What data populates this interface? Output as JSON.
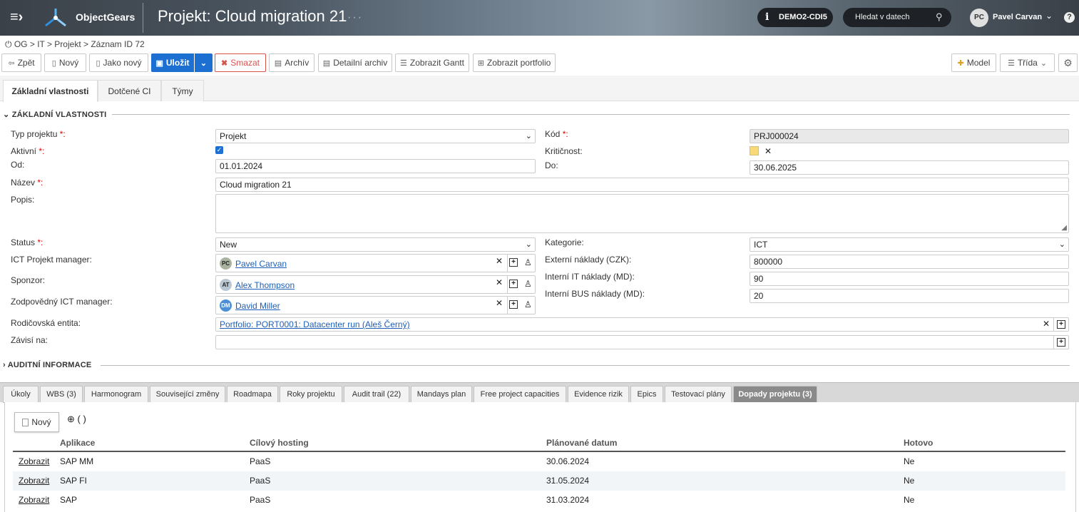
{
  "header": {
    "brand": "ObjectGears",
    "title": "Projekt: Cloud migration 21",
    "env": "DEMO2-CDI5",
    "search_placeholder": "Hledat v datech",
    "user_initials": "PC",
    "user_name": "Pavel Carvan"
  },
  "breadcrumb": "OG > IT > Projekt > Záznam ID 72",
  "toolbar": {
    "back": "Zpět",
    "new": "Nový",
    "as_new": "Jako nový",
    "save": "Uložit",
    "delete": "Smazat",
    "archive": "Archív",
    "detail_archive": "Detailní archiv",
    "gantt": "Zobrazit Gantt",
    "portfolio": "Zobrazit portfolio",
    "model": "Model",
    "class": "Třída"
  },
  "top_tabs": [
    "Základní vlastnosti",
    "Dotčené CI",
    "Týmy"
  ],
  "sections": {
    "basic": "ZÁKLADNÍ VLASTNOSTI",
    "audit": "AUDITNÍ INFORMACE"
  },
  "form": {
    "typ_label": "Typ projektu",
    "typ_value": "Projekt",
    "aktivni_label": "Aktivní",
    "od_label": "Od:",
    "od_value": "01.01.2024",
    "nazev_label": "Název",
    "nazev_value": "Cloud migration 21",
    "popis_label": "Popis:",
    "status_label": "Status",
    "status_value": "New",
    "pm_label": "ICT Projekt manager:",
    "sponzor_label": "Sponzor:",
    "zodp_label": "Zodpovědný ICT manager:",
    "rodic_label": "Rodičovská entita:",
    "rodic_value": "Portfolio: PORT0001: Datacenter run (Aleš Černý)",
    "zavisi_label": "Závisí na:",
    "kod_label": "Kód",
    "kod_value": "PRJ000024",
    "kriticnost_label": "Kritičnost:",
    "do_label": "Do:",
    "do_value": "30.06.2025",
    "kategorie_label": "Kategorie:",
    "kategorie_value": "ICT",
    "ext_label": "Externí náklady (CZK):",
    "ext_value": "800000",
    "intit_label": "Interní IT náklady (MD):",
    "intit_value": "90",
    "intbus_label": "Interní BUS náklady (MD):",
    "intbus_value": "20",
    "req_mark": "*:"
  },
  "people": {
    "pm": {
      "initials": "PC",
      "name": "Pavel Carvan",
      "color": "#a8b3a0"
    },
    "sponzor": {
      "initials": "AT",
      "name": "Alex Thompson",
      "color": "#b9c7d3"
    },
    "zodp": {
      "initials": "DM",
      "name": "David Miller",
      "color": "#4b8fd6"
    }
  },
  "bottom_tabs": [
    "Úkoly",
    "WBS (3)",
    "Harmonogram",
    "Související změny",
    "Roadmapa",
    "Roky projektu",
    "Audit trail (22)",
    "Mandays plan",
    "Free project capacities",
    "Evidence rizik",
    "Epics",
    "Testovací plány",
    "Dopady projektu (3)"
  ],
  "table": {
    "new_label": "Nový",
    "count_label": "( )",
    "headers": [
      "Aplikace",
      "Cílový hosting",
      "Plánované datum",
      "Hotovo"
    ],
    "link_label": "Zobrazit",
    "rows": [
      [
        "SAP MM",
        "PaaS",
        "30.06.2024",
        "Ne"
      ],
      [
        "SAP FI",
        "PaaS",
        "31.05.2024",
        "Ne"
      ],
      [
        "SAP",
        "PaaS",
        "31.03.2024",
        "Ne"
      ]
    ]
  }
}
